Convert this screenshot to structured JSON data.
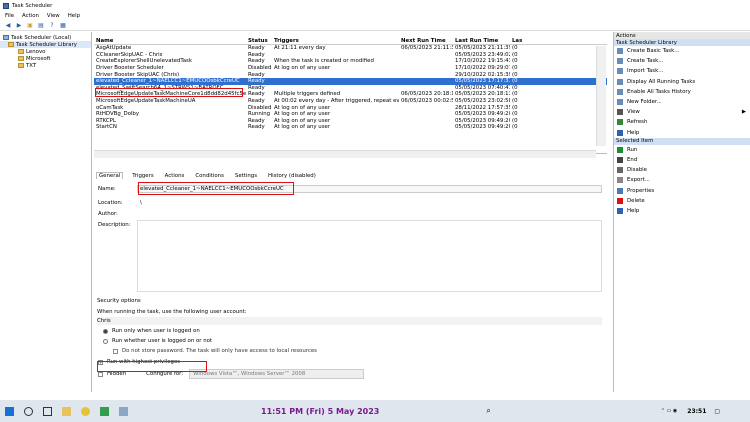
{
  "window": {
    "title": "Task Scheduler"
  },
  "menu": [
    "File",
    "Action",
    "View",
    "Help"
  ],
  "tree": {
    "root": "Task Scheduler (Local)",
    "library": "Task Scheduler Library",
    "folders": [
      "Lenovo",
      "Microsoft",
      "TXT"
    ]
  },
  "tasklist": {
    "columns": [
      "Name",
      "Status",
      "Triggers",
      "Next Run Time",
      "Last Run Time",
      "Las"
    ],
    "rows": [
      [
        "AsgAtUpdate",
        "Ready",
        "At 21:11 every day",
        "06/05/2023 21:11:38",
        "05/05/2023 21:11:39",
        "(0"
      ],
      [
        "CCleanerSkipUAC - Chris",
        "Ready",
        "",
        "",
        "05/05/2023 23:49:02",
        "(0"
      ],
      [
        "CreateExplorerShellUnelevatedTask",
        "Ready",
        "When the task is created or modified",
        "",
        "17/10/2022 19:15:43",
        "(0"
      ],
      [
        "Driver Booster Scheduler",
        "Disabled",
        "At log on of any user",
        "",
        "17/10/2022 09:29:07",
        "(0"
      ],
      [
        "Driver Booster SkipUAC (Chris)",
        "Ready",
        "",
        "",
        "29/10/2022 02:15:39",
        "(0"
      ],
      [
        "elevated_Ccleaner_1~NAELCC1~EMUCOOsbkCcreUC",
        "Ready",
        "",
        "",
        "05/05/2023 17:17:31",
        "(0"
      ],
      [
        "elevated_SwiftSearch64_1~STRWS1~BATROFC",
        "Ready",
        "",
        "",
        "05/05/2023 07:40:41",
        "(0"
      ],
      [
        "MicrosoftEdgeUpdateTaskMachineCore1d8dd82d45fc5e",
        "Ready",
        "Multiple triggers defined",
        "06/05/2023 20:18:13",
        "05/05/2023 20:18:13",
        "(0"
      ],
      [
        "MicrosoftEdgeUpdateTaskMachineUA",
        "Ready",
        "At 00:02 every day - After triggered, repeat every 1 hour for a duration of 1 day.",
        "06/05/2023 00:02:57",
        "05/05/2023 23:02:58",
        "(0"
      ],
      [
        "oCamTask",
        "Disabled",
        "At log on of any user",
        "",
        "28/11/2022 17:57:35",
        "(0"
      ],
      [
        "RtHDVBg_Dolby",
        "Running",
        "At log on of any user",
        "",
        "05/05/2023 09:49:20",
        "(0"
      ],
      [
        "RTKCPL",
        "Ready",
        "At log on of any user",
        "",
        "05/05/2023 09:49:20",
        "(0"
      ],
      [
        "StartCN",
        "Ready",
        "At log on of any user",
        "",
        "05/05/2023 09:49:20",
        "(0"
      ]
    ],
    "selected_index": 5
  },
  "tabs": [
    "General",
    "Triggers",
    "Actions",
    "Conditions",
    "Settings",
    "History (disabled)"
  ],
  "general": {
    "name_label": "Name:",
    "name_value": "elevated_Ccleaner_1~NAELCC1~EMUCOOsbkCcreUC",
    "location_label": "Location:",
    "location_value": "\\",
    "author_label": "Author:",
    "description_label": "Description:",
    "security_header": "Security options",
    "run_account_text": "When running the task, use the following user account:",
    "account": "Chris",
    "opt_logged_on": "Run only when user is logged on",
    "opt_logged_or_not": "Run whether user is logged on or not",
    "opt_no_password": "Do not store password.  The task will only have access to local resources",
    "opt_highest": "Run with highest privileges",
    "hidden_label": "Hidden",
    "configure_label": "Configure for:",
    "configure_value": "Windows Vista™, Windows Server™ 2008"
  },
  "actions": {
    "header1": "Actions",
    "section1": "Task Scheduler Library",
    "items1": [
      "Create Basic Task...",
      "Create Task...",
      "Import Task...",
      "Display All Running Tasks",
      "Enable All Tasks History",
      "New Folder...",
      "View",
      "Refresh",
      "Help"
    ],
    "section2": "Selected Item",
    "items2": [
      "Run",
      "End",
      "Disable",
      "Export...",
      "Properties",
      "Delete",
      "Help"
    ]
  },
  "taskbar": {
    "datetime": "11:51 PM (Fri) 5 May 2023",
    "clock": "23:51"
  },
  "colors": {
    "selection": "#2f6fd0",
    "annotation": "#dd1111",
    "datetime": "#7a1a8c"
  }
}
